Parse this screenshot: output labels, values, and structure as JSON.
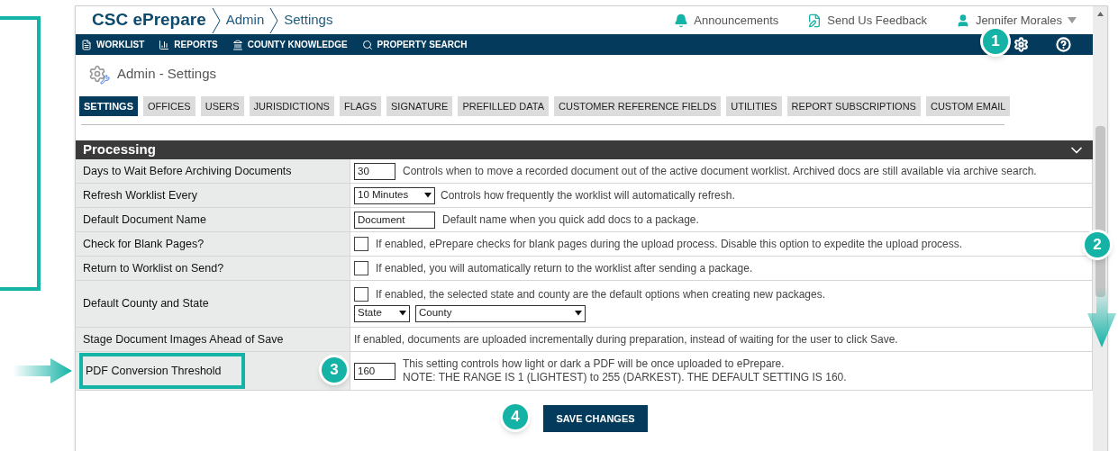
{
  "breadcrumb": [
    "CSC ePrepare",
    "Admin",
    "Settings"
  ],
  "header_links": [
    {
      "kind": "bell",
      "label": "Announcements"
    },
    {
      "kind": "feedback",
      "label": "Send Us Feedback"
    },
    {
      "kind": "user",
      "label": "Jennifer Morales"
    }
  ],
  "nav": [
    {
      "kind": "document",
      "label": "WORKLIST"
    },
    {
      "kind": "chart",
      "label": "REPORTS"
    },
    {
      "kind": "building",
      "label": "COUNTY KNOWLEDGE"
    },
    {
      "kind": "search",
      "label": "PROPERTY SEARCH"
    }
  ],
  "page_title": "Admin - Settings",
  "tabs": [
    {
      "label": "SETTINGS",
      "selected": true
    },
    {
      "label": "OFFICES",
      "selected": false
    },
    {
      "label": "USERS",
      "selected": false
    },
    {
      "label": "JURISDICTIONS",
      "selected": false
    },
    {
      "label": "FLAGS",
      "selected": false
    },
    {
      "label": "SIGNATURE",
      "selected": false
    },
    {
      "label": "PREFILLED DATA",
      "selected": false
    },
    {
      "label": "CUSTOMER REFERENCE FIELDS",
      "selected": false
    },
    {
      "label": "UTILITIES",
      "selected": false
    },
    {
      "label": "REPORT SUBSCRIPTIONS",
      "selected": false
    },
    {
      "label": "CUSTOM EMAIL",
      "selected": false
    }
  ],
  "section": {
    "title": "Processing",
    "expanded": true
  },
  "rows": [
    {
      "kind": "input",
      "label": "Days to Wait Before Archiving Documents",
      "value": "30",
      "description": "Controls when to move a recorded document out of the active document worklist. Archived docs are still available via archive search.",
      "highlighted": false
    },
    {
      "kind": "select",
      "label": "Refresh Worklist Every",
      "value": "10 Minutes",
      "description": "Controls how frequently the worklist will automatically refresh.",
      "highlighted": false
    },
    {
      "kind": "input",
      "label": "Default Document Name",
      "value": "Document",
      "description": "Default name when you quick add docs to a package.",
      "highlighted": false
    },
    {
      "kind": "checkbox",
      "label": "Check for Blank Pages?",
      "checked": false,
      "description": "If enabled, ePrepare checks for blank pages during the upload process. Disable this option to expedite the upload process.",
      "highlighted": false
    },
    {
      "kind": "checkbox",
      "label": "Return to Worklist on Send?",
      "checked": false,
      "description": "If enabled, you will automatically return to the worklist after sending a package.",
      "highlighted": false
    },
    {
      "kind": "county",
      "label": "Default County and State",
      "checked": false,
      "description": "If enabled, the selected state and county are the default options when creating new packages.",
      "state": "State",
      "county": "County",
      "highlighted": false
    },
    {
      "kind": "text",
      "label": "Stage Document Images Ahead of Save",
      "description": "If enabled, documents are uploaded incrementally during preparation, instead of waiting for the user to click Save.",
      "highlighted": false
    },
    {
      "kind": "input",
      "label": "PDF Conversion Threshold",
      "value": "160",
      "description": "This setting controls how light or dark a PDF will be once uploaded to ePrepare.",
      "note": "NOTE: THE RANGE IS 1 (LIGHTEST) to 255 (DARKEST). THE DEFAULT SETTING IS 160.",
      "highlighted": true
    }
  ],
  "save_button": "SAVE CHANGES",
  "callouts": [
    "1",
    "2",
    "3",
    "4"
  ]
}
